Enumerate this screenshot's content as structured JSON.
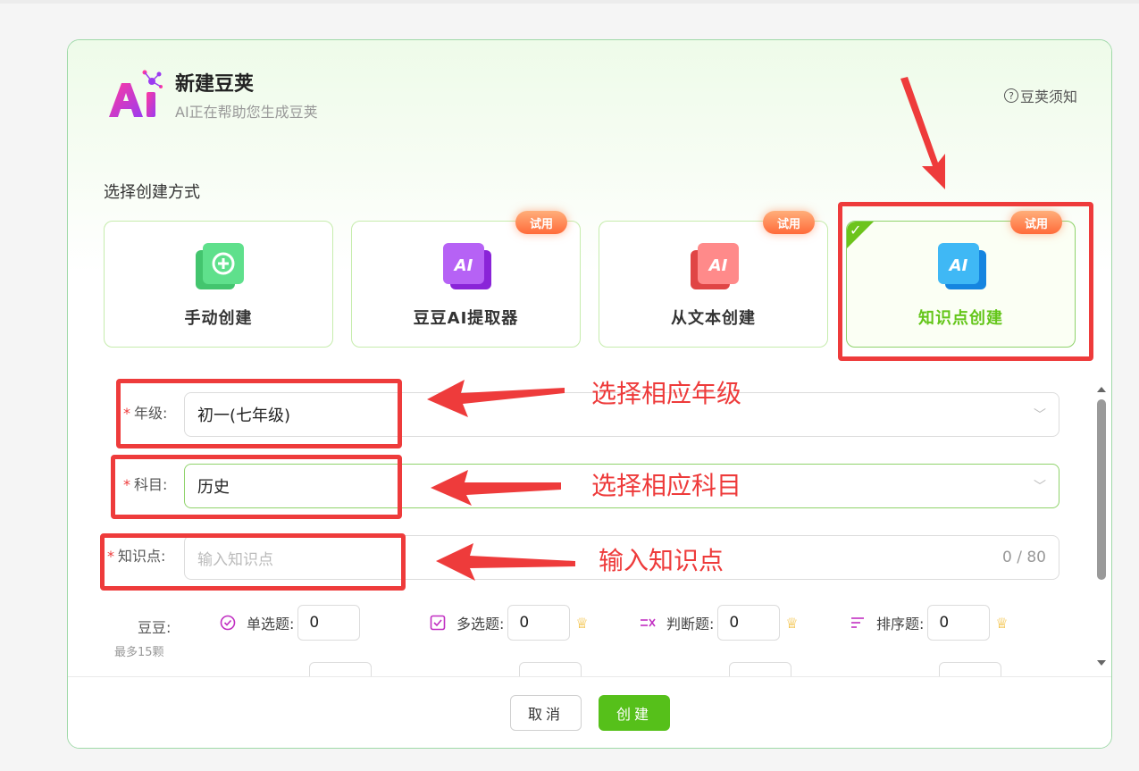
{
  "header": {
    "title": "新建豆荚",
    "subtitle": "AI正在帮助您生成豆荚",
    "help_link": "豆荚须知"
  },
  "creation": {
    "section_label": "选择创建方式",
    "trial_badge": "试用",
    "cards": [
      {
        "label": "手动创建",
        "icon": "plus-card-icon",
        "color": "#3ccf6e",
        "trial": false,
        "selected": false
      },
      {
        "label": "豆豆AI提取器",
        "icon": "ai-purple-icon",
        "color": "#a53bf0",
        "trial": true,
        "selected": false
      },
      {
        "label": "从文本创建",
        "icon": "ai-red-icon",
        "color": "#f25a5a",
        "trial": true,
        "selected": false
      },
      {
        "label": "知识点创建",
        "icon": "ai-blue-icon",
        "color": "#1e9df0",
        "trial": true,
        "selected": true
      }
    ]
  },
  "form": {
    "grade": {
      "label": "年级:",
      "value": "初一(七年级)"
    },
    "subject": {
      "label": "科目:",
      "value": "历史"
    },
    "knowledge": {
      "label": "知识点:",
      "placeholder": "输入知识点",
      "counter": "0 / 80"
    }
  },
  "annotations": {
    "grade": "选择相应年级",
    "subject": "选择相应科目",
    "knowledge": "输入知识点"
  },
  "doudou": {
    "label": "豆豆:",
    "sub": "最多15颗",
    "types": [
      {
        "label": "单选题:",
        "value": "0",
        "icon": "single-choice-icon"
      },
      {
        "label": "多选题:",
        "value": "0",
        "icon": "multi-choice-icon"
      },
      {
        "label": "判断题:",
        "value": "0",
        "icon": "true-false-icon"
      },
      {
        "label": "排序题:",
        "value": "0",
        "icon": "sort-icon"
      }
    ]
  },
  "footer": {
    "cancel": "取消",
    "create": "创建"
  },
  "colors": {
    "accent_green": "#56c01a",
    "annotation_red": "#ee3b3b",
    "trial_orange": "#ff6b3a"
  }
}
